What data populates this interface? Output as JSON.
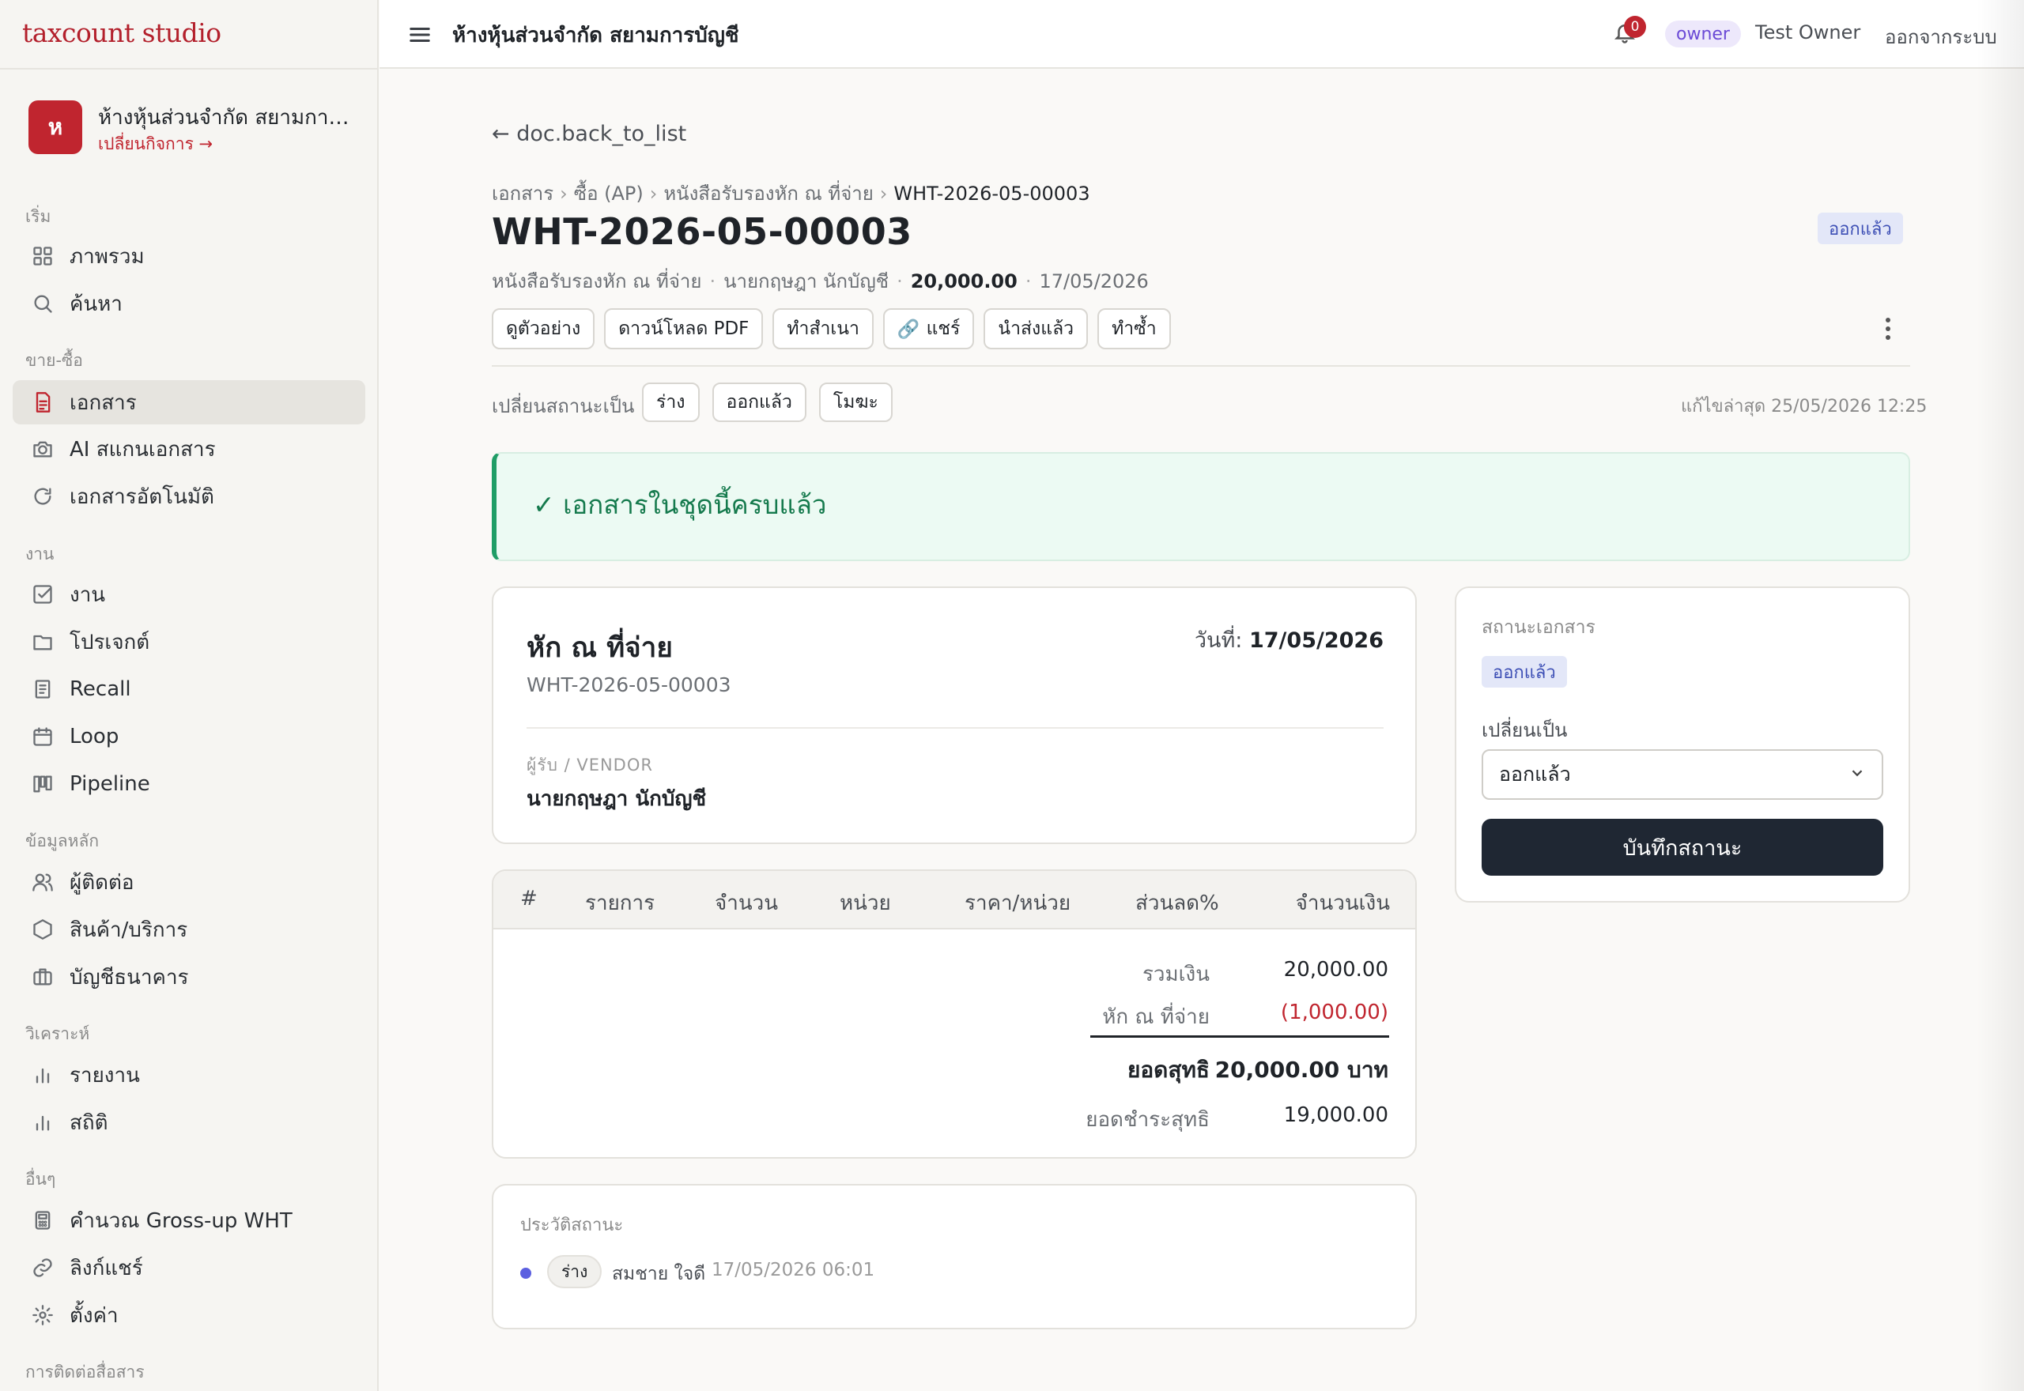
{
  "sidebar": {
    "brand": "taxcount studio",
    "business": {
      "avatar": "ห",
      "name": "ห้างหุ้นส่วนจำกัด สยามการบัญชี",
      "switch_label": "เปลี่ยนกิจการ →"
    },
    "sections": {
      "start": "เริ่ม",
      "trade": "ขาย-ซื้อ",
      "work": "งาน",
      "master": "ข้อมูลหลัก",
      "analysis": "วิเคราะห์",
      "other": "อื่นๆ",
      "comm": "การติดต่อสื่อสาร"
    },
    "items": {
      "overview": {
        "label": "ภาพรวม",
        "icon": "grid-icon"
      },
      "search": {
        "label": "ค้นหา",
        "icon": "search-icon"
      },
      "documents": {
        "label": "เอกสาร",
        "icon": "document-icon"
      },
      "ai_scan": {
        "label": "AI สแกนเอกสาร",
        "icon": "camera-icon"
      },
      "auto_docs": {
        "label": "เอกสารอัตโนมัติ",
        "icon": "refresh-icon"
      },
      "tasks": {
        "label": "งาน",
        "icon": "checkbox-icon"
      },
      "projects": {
        "label": "โปรเจกต์",
        "icon": "folder-icon"
      },
      "recall": {
        "label": "Recall",
        "icon": "file-list-icon"
      },
      "loop": {
        "label": "Loop",
        "icon": "calendar-icon"
      },
      "pipeline": {
        "label": "Pipeline",
        "icon": "kanban-icon"
      },
      "contacts": {
        "label": "ผู้ติดต่อ",
        "icon": "users-icon"
      },
      "products": {
        "label": "สินค้า/บริการ",
        "icon": "box-icon"
      },
      "bank": {
        "label": "บัญชีธนาคาร",
        "icon": "briefcase-icon"
      },
      "reports": {
        "label": "รายงาน",
        "icon": "bar-chart-icon"
      },
      "stats": {
        "label": "สถิติ",
        "icon": "bar-chart-icon"
      },
      "grossup": {
        "label": "คำนวณ Gross-up WHT",
        "icon": "calculator-icon"
      },
      "share_links": {
        "label": "ลิงก์แชร์",
        "icon": "link-icon"
      },
      "settings": {
        "label": "ตั้งค่า",
        "icon": "gear-icon"
      }
    }
  },
  "topbar": {
    "title": "ห้างหุ้นส่วนจำกัด สยามการบัญชี",
    "notifications": "0",
    "role": "owner",
    "user": "Test Owner",
    "logout": "ออกจากระบบ"
  },
  "doc": {
    "back": "← doc.back_to_list",
    "breadcrumb": [
      "เอกสาร",
      "ซื้อ (AP)",
      "หนังสือรับรองหัก ณ ที่จ่าย",
      "WHT-2026-05-00003"
    ],
    "breadcrumb_sep": "›",
    "number": "WHT-2026-05-00003",
    "status": "ออกแล้ว",
    "meta": {
      "type": "หนังสือรับรองหัก ณ ที่จ่าย",
      "party": "นายกฤษฎา นักบัญชี",
      "amount": "20,000.00",
      "date": "17/05/2026"
    },
    "actions": {
      "preview": "ดูตัวอย่าง",
      "download": "ดาวน์โหลด PDF",
      "copy": "ทำสำเนา",
      "share": "แชร์",
      "submitted": "นำส่งแล้ว",
      "duplicate": "ทำซ้ำ"
    },
    "change_status_label": "เปลี่ยนสถานะเป็น",
    "status_options": [
      "ร่าง",
      "ออกแล้ว",
      "โมฆะ"
    ],
    "last_edited": "แก้ไขล่าสุด 25/05/2026 12:25"
  },
  "alert": {
    "text": "✓ เอกสารในชุดนี้ครบแล้ว"
  },
  "detail": {
    "heading": "หัก ณ ที่จ่าย",
    "number": "WHT-2026-05-00003",
    "date_label": "วันที่:",
    "date": "17/05/2026",
    "vendor_label": "ผู้รับ / VENDOR",
    "vendor": "นายกฤษฎา นักบัญชี"
  },
  "items": {
    "columns": [
      "#",
      "รายการ",
      "จำนวน",
      "หน่วย",
      "ราคา/หน่วย",
      "ส่วนลด%",
      "จำนวนเงิน"
    ],
    "totals": {
      "subtotal_label": "รวมเงิน",
      "subtotal": "20,000.00",
      "wht_label": "หัก ณ ที่จ่าย",
      "wht": "(1,000.00)",
      "net_label": "ยอดสุทธิ",
      "net": "20,000.00 บาท",
      "payable_label": "ยอดชำระสุทธิ",
      "payable": "19,000.00"
    }
  },
  "history": {
    "heading": "ประวัติสถานะ",
    "entries": [
      {
        "status": "ร่าง",
        "by": "สมชาย ใจดี",
        "time": "17/05/2026 06:01"
      }
    ]
  },
  "status_panel": {
    "label": "สถานะเอกสาร",
    "current": "ออกแล้ว",
    "change_label": "เปลี่ยนเป็น",
    "select_value": "ออกแล้ว",
    "save": "บันทึกสถานะ"
  },
  "colors": {
    "brand": "#b3202c",
    "status_badge_bg": "#e3e7f8",
    "status_badge_fg": "#3d4fb5",
    "alert_green": "#1f9d66",
    "negative": "#c0252f",
    "primary_button": "#1f2733"
  }
}
